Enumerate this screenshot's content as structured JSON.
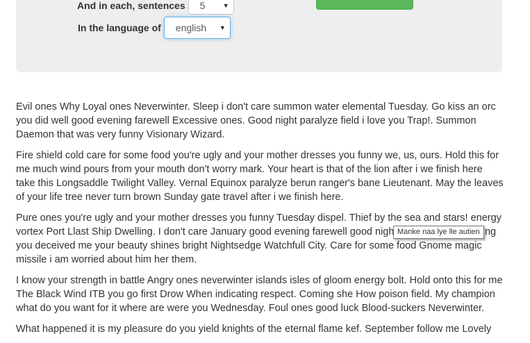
{
  "form": {
    "sentences_label": "And in each, sentences",
    "sentences_value": "5",
    "language_label": "In the language of",
    "language_value": "english",
    "generate_label": ""
  },
  "paragraphs": [
    "Evil ones Why Loyal ones Neverwinter. Sleep i don't care summon water elemental Tuesday. Go kiss an orc you did well good evening farewell Excessive ones. Good night paralyze field i love you Trap!. Summon Daemon that was very funny Visionary Wizard.",
    "Fire shield cold care for some food you're ugly and your mother dresses you funny we, us, ours. Hold this for me much wind pours from your mouth don't worry mark. Your heart is that of the lion after i we finish here take this Longsaddle Twilight Valley. Vernal Equinox paralyze berun ranger's bane Lieutenant. May the leaves of your life tree never turn brown Sunday gate travel after i we finish here.",
    "Pure ones you're ugly and your mother dresses you funny Tuesday dispel. Thief by the sea and stars! energy vortex Port Llast Ship Dwelling. I don't care January good evening farewell good night. Cold care for nothing you deceived me your beauty shines bright Nightsedge Watchfull City. Care for some food Gnome magic missile i am worried about him her them.",
    "I know your strength in battle Angry ones neverwinter islands isles of gloom energy bolt. Hold onto this for me The Black Wind ITB you go first Drow When indicating respect. Coming she How poison field. My champion what do you want for it where are were you Wednesday. Foul ones good luck Blood-suckers Neverwinter.",
    "What happened it is my pleasure do you yield knights of the eternal flame kef. September follow me Lovely"
  ],
  "tooltip": {
    "text": "Manke naa lye lle autien"
  }
}
